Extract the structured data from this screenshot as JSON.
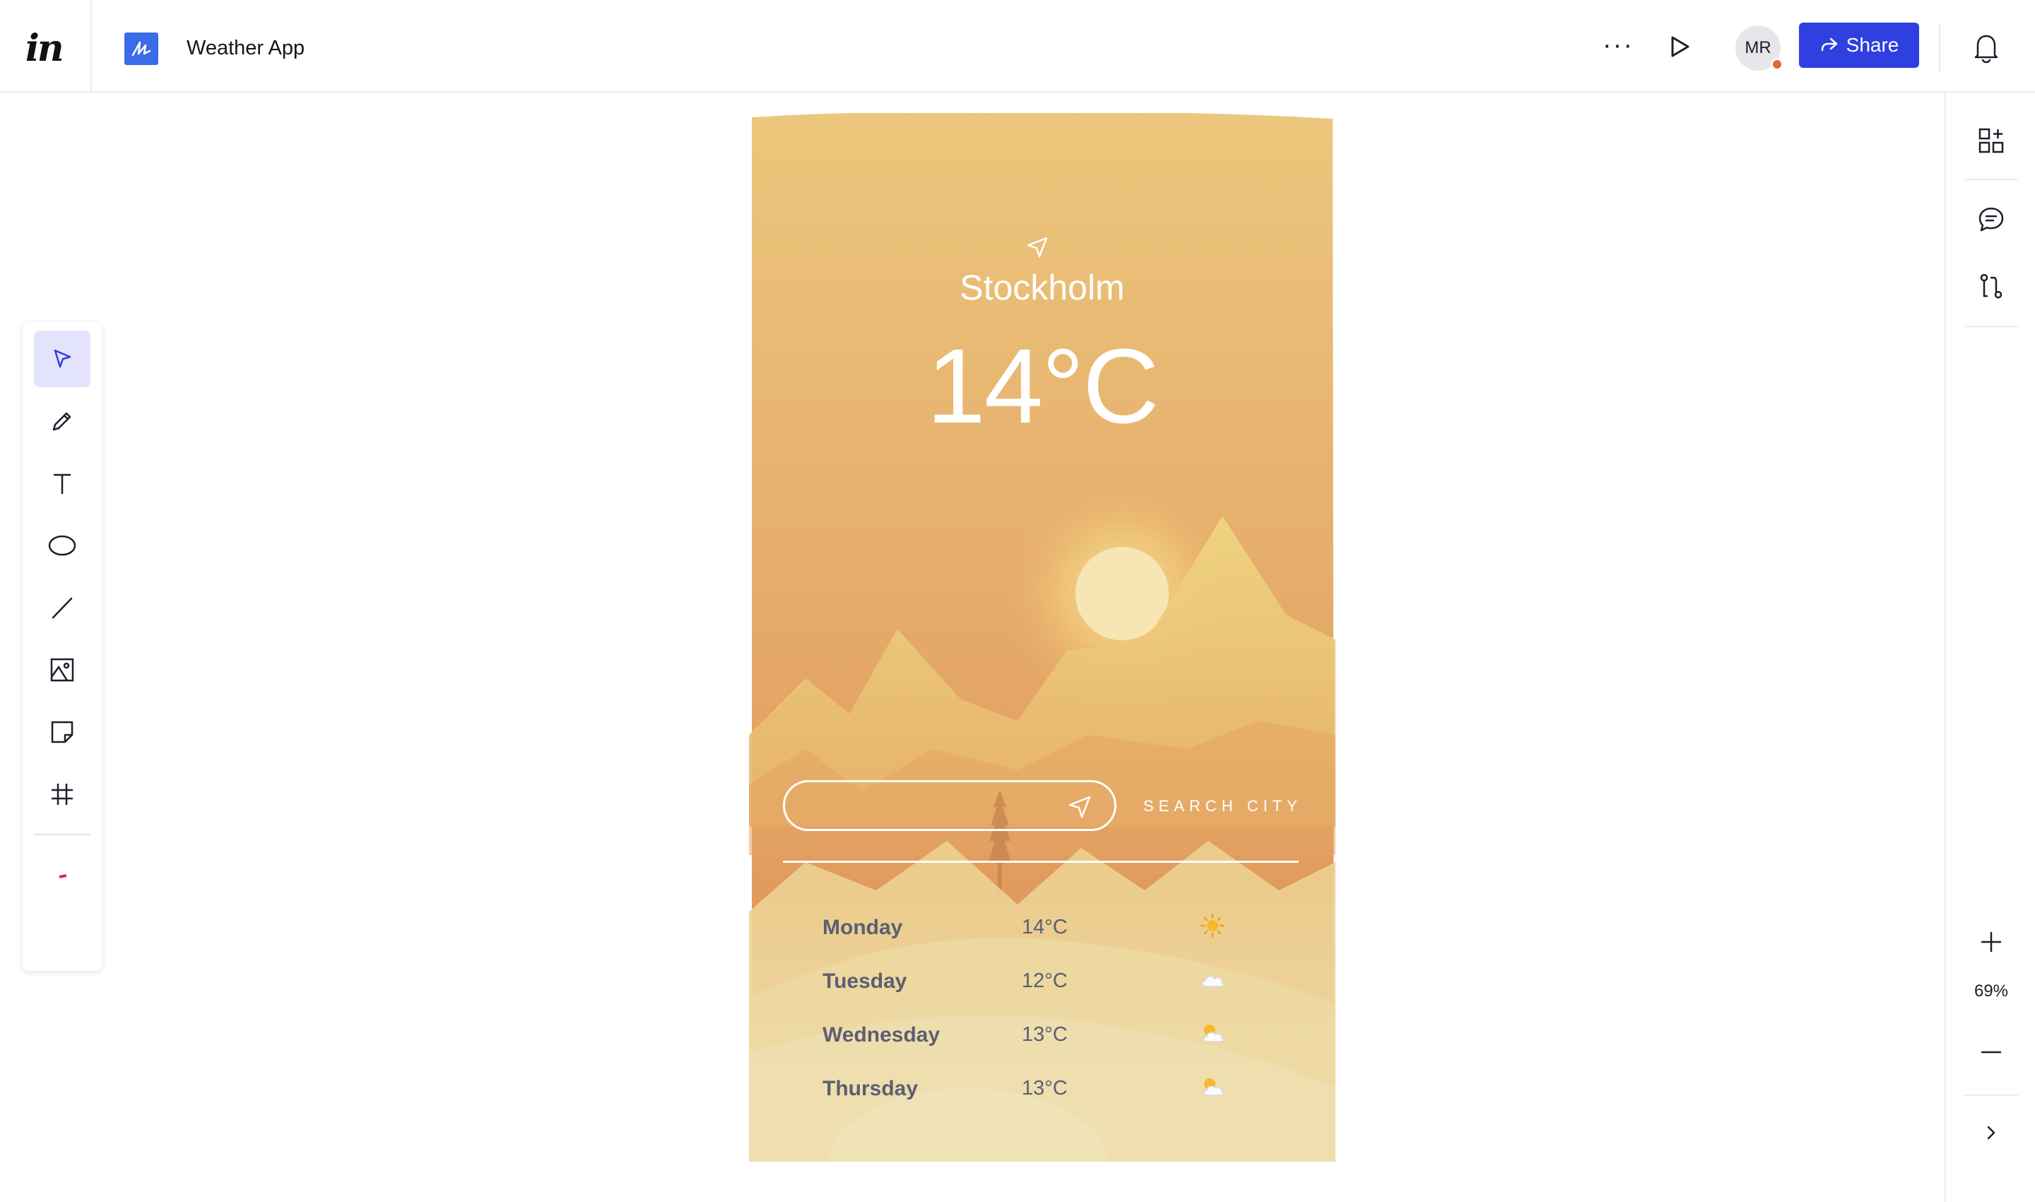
{
  "app": {
    "logo": "in",
    "project_title": "Weather App",
    "avatar_initials": "MR",
    "share_label": "Share",
    "more_label": "···"
  },
  "colors": {
    "share_button": "#2f3fe0",
    "project_icon": "#3b6ce8",
    "active_tool_bg": "#e3e3fb",
    "avatar_status": "#e8643a",
    "sky_top": "#ecc77c",
    "sky_mid": "#e3a366",
    "ground": "#ecd8a0"
  },
  "toolbar": {
    "tools": [
      {
        "name": "select-tool",
        "icon": "cursor-icon",
        "active": true
      },
      {
        "name": "pencil-tool",
        "icon": "pencil-icon",
        "active": false
      },
      {
        "name": "text-tool",
        "icon": "text-icon",
        "active": false
      },
      {
        "name": "ellipse-tool",
        "icon": "ellipse-icon",
        "active": false
      },
      {
        "name": "line-tool",
        "icon": "line-icon",
        "active": false
      },
      {
        "name": "image-tool",
        "icon": "image-icon",
        "active": false
      },
      {
        "name": "sticky-note-tool",
        "icon": "sticky-note-icon",
        "active": false
      },
      {
        "name": "frame-tool",
        "icon": "grid-icon",
        "active": false
      }
    ]
  },
  "rightbar": {
    "zoom_level": "69%",
    "icons": [
      "add-widget-icon",
      "comment-icon",
      "flow-icon",
      "plus-icon",
      "minus-icon",
      "chevron-right-icon"
    ]
  },
  "weather": {
    "city": "Stockholm",
    "temperature": "14°C",
    "search_label": "SEARCH CITY",
    "search_value": "",
    "forecast": [
      {
        "day": "Monday",
        "temp": "14°C",
        "icon": "sun-icon"
      },
      {
        "day": "Tuesday",
        "temp": "12°C",
        "icon": "cloud-icon"
      },
      {
        "day": "Wednesday",
        "temp": "13°C",
        "icon": "partly-cloudy-icon"
      },
      {
        "day": "Thursday",
        "temp": "13°C",
        "icon": "partly-cloudy-icon"
      }
    ]
  }
}
